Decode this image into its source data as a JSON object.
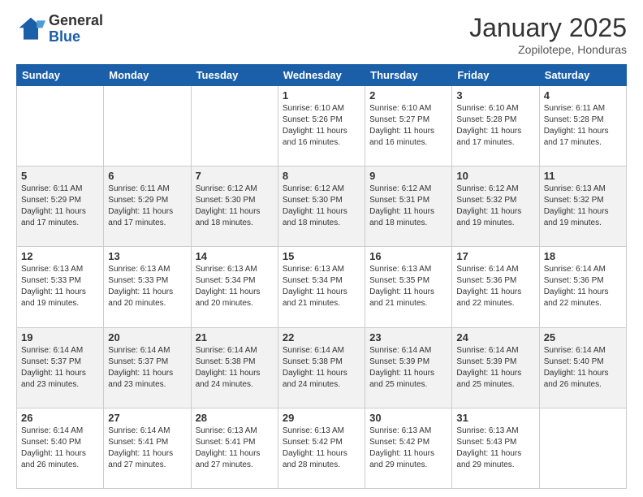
{
  "header": {
    "logo_general": "General",
    "logo_blue": "Blue",
    "month_title": "January 2025",
    "subtitle": "Zopilotepe, Honduras"
  },
  "days_of_week": [
    "Sunday",
    "Monday",
    "Tuesday",
    "Wednesday",
    "Thursday",
    "Friday",
    "Saturday"
  ],
  "weeks": [
    [
      {
        "day": "",
        "text": ""
      },
      {
        "day": "",
        "text": ""
      },
      {
        "day": "",
        "text": ""
      },
      {
        "day": "1",
        "text": "Sunrise: 6:10 AM\nSunset: 5:26 PM\nDaylight: 11 hours and 16 minutes."
      },
      {
        "day": "2",
        "text": "Sunrise: 6:10 AM\nSunset: 5:27 PM\nDaylight: 11 hours and 16 minutes."
      },
      {
        "day": "3",
        "text": "Sunrise: 6:10 AM\nSunset: 5:28 PM\nDaylight: 11 hours and 17 minutes."
      },
      {
        "day": "4",
        "text": "Sunrise: 6:11 AM\nSunset: 5:28 PM\nDaylight: 11 hours and 17 minutes."
      }
    ],
    [
      {
        "day": "5",
        "text": "Sunrise: 6:11 AM\nSunset: 5:29 PM\nDaylight: 11 hours and 17 minutes."
      },
      {
        "day": "6",
        "text": "Sunrise: 6:11 AM\nSunset: 5:29 PM\nDaylight: 11 hours and 17 minutes."
      },
      {
        "day": "7",
        "text": "Sunrise: 6:12 AM\nSunset: 5:30 PM\nDaylight: 11 hours and 18 minutes."
      },
      {
        "day": "8",
        "text": "Sunrise: 6:12 AM\nSunset: 5:30 PM\nDaylight: 11 hours and 18 minutes."
      },
      {
        "day": "9",
        "text": "Sunrise: 6:12 AM\nSunset: 5:31 PM\nDaylight: 11 hours and 18 minutes."
      },
      {
        "day": "10",
        "text": "Sunrise: 6:12 AM\nSunset: 5:32 PM\nDaylight: 11 hours and 19 minutes."
      },
      {
        "day": "11",
        "text": "Sunrise: 6:13 AM\nSunset: 5:32 PM\nDaylight: 11 hours and 19 minutes."
      }
    ],
    [
      {
        "day": "12",
        "text": "Sunrise: 6:13 AM\nSunset: 5:33 PM\nDaylight: 11 hours and 19 minutes."
      },
      {
        "day": "13",
        "text": "Sunrise: 6:13 AM\nSunset: 5:33 PM\nDaylight: 11 hours and 20 minutes."
      },
      {
        "day": "14",
        "text": "Sunrise: 6:13 AM\nSunset: 5:34 PM\nDaylight: 11 hours and 20 minutes."
      },
      {
        "day": "15",
        "text": "Sunrise: 6:13 AM\nSunset: 5:34 PM\nDaylight: 11 hours and 21 minutes."
      },
      {
        "day": "16",
        "text": "Sunrise: 6:13 AM\nSunset: 5:35 PM\nDaylight: 11 hours and 21 minutes."
      },
      {
        "day": "17",
        "text": "Sunrise: 6:14 AM\nSunset: 5:36 PM\nDaylight: 11 hours and 22 minutes."
      },
      {
        "day": "18",
        "text": "Sunrise: 6:14 AM\nSunset: 5:36 PM\nDaylight: 11 hours and 22 minutes."
      }
    ],
    [
      {
        "day": "19",
        "text": "Sunrise: 6:14 AM\nSunset: 5:37 PM\nDaylight: 11 hours and 23 minutes."
      },
      {
        "day": "20",
        "text": "Sunrise: 6:14 AM\nSunset: 5:37 PM\nDaylight: 11 hours and 23 minutes."
      },
      {
        "day": "21",
        "text": "Sunrise: 6:14 AM\nSunset: 5:38 PM\nDaylight: 11 hours and 24 minutes."
      },
      {
        "day": "22",
        "text": "Sunrise: 6:14 AM\nSunset: 5:38 PM\nDaylight: 11 hours and 24 minutes."
      },
      {
        "day": "23",
        "text": "Sunrise: 6:14 AM\nSunset: 5:39 PM\nDaylight: 11 hours and 25 minutes."
      },
      {
        "day": "24",
        "text": "Sunrise: 6:14 AM\nSunset: 5:39 PM\nDaylight: 11 hours and 25 minutes."
      },
      {
        "day": "25",
        "text": "Sunrise: 6:14 AM\nSunset: 5:40 PM\nDaylight: 11 hours and 26 minutes."
      }
    ],
    [
      {
        "day": "26",
        "text": "Sunrise: 6:14 AM\nSunset: 5:40 PM\nDaylight: 11 hours and 26 minutes."
      },
      {
        "day": "27",
        "text": "Sunrise: 6:14 AM\nSunset: 5:41 PM\nDaylight: 11 hours and 27 minutes."
      },
      {
        "day": "28",
        "text": "Sunrise: 6:13 AM\nSunset: 5:41 PM\nDaylight: 11 hours and 27 minutes."
      },
      {
        "day": "29",
        "text": "Sunrise: 6:13 AM\nSunset: 5:42 PM\nDaylight: 11 hours and 28 minutes."
      },
      {
        "day": "30",
        "text": "Sunrise: 6:13 AM\nSunset: 5:42 PM\nDaylight: 11 hours and 29 minutes."
      },
      {
        "day": "31",
        "text": "Sunrise: 6:13 AM\nSunset: 5:43 PM\nDaylight: 11 hours and 29 minutes."
      },
      {
        "day": "",
        "text": ""
      }
    ]
  ]
}
